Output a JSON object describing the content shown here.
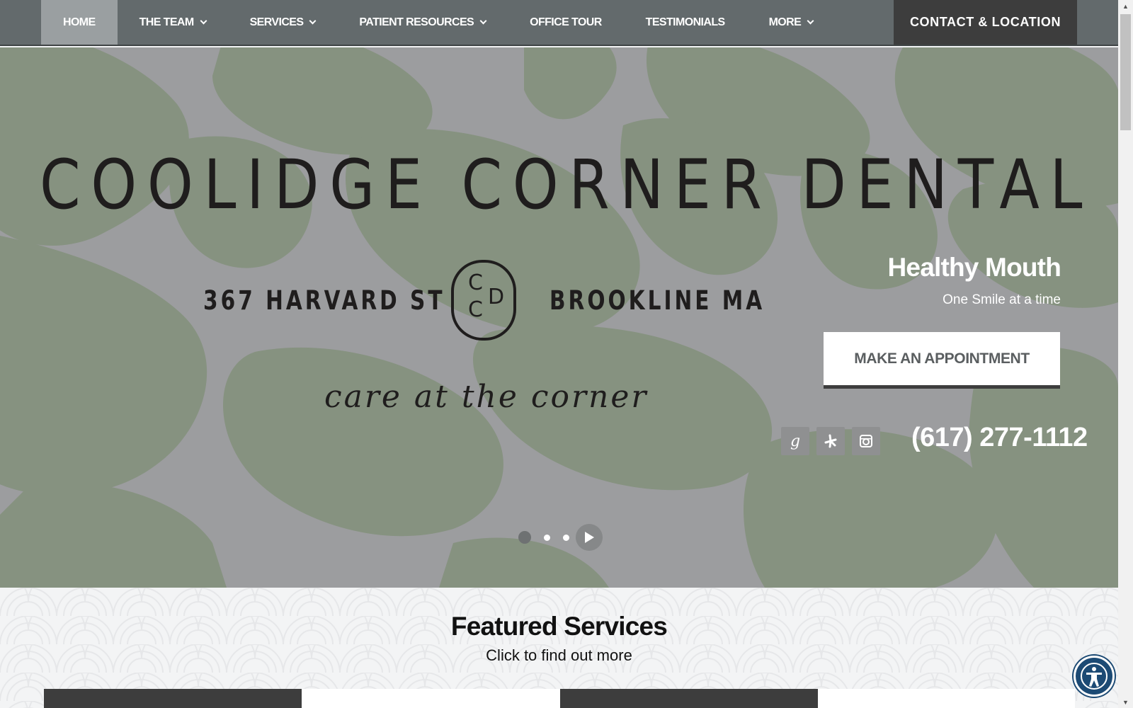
{
  "nav": {
    "items": [
      {
        "label": "HOME",
        "active": true,
        "dropdown": false
      },
      {
        "label": "THE TEAM",
        "active": false,
        "dropdown": true
      },
      {
        "label": "SERVICES",
        "active": false,
        "dropdown": true
      },
      {
        "label": "PATIENT RESOURCES",
        "active": false,
        "dropdown": true
      },
      {
        "label": "OFFICE TOUR",
        "active": false,
        "dropdown": false
      },
      {
        "label": "TESTIMONIALS",
        "active": false,
        "dropdown": false
      },
      {
        "label": "MORE",
        "active": false,
        "dropdown": true
      }
    ],
    "contact_label": "CONTACT & LOCATION"
  },
  "hero": {
    "brand": "COOLIDGE CORNER DENTAL",
    "address": "367 HARVARD ST",
    "city": "BROOKLINE MA",
    "logo_letters": [
      "C",
      "C",
      "D"
    ],
    "tagline": "care at the corner",
    "title": "Healthy Mouth",
    "subtitle": "One Smile at a time",
    "appointment_label": "MAKE AN APPOINTMENT",
    "phone": "(617) 277-1112",
    "social": [
      {
        "name": "google-icon",
        "glyph": "g"
      },
      {
        "name": "yelp-icon",
        "glyph": "✻"
      },
      {
        "name": "instagram-icon",
        "glyph": "◘"
      }
    ],
    "slides": 3,
    "active_slide": 1
  },
  "featured": {
    "title": "Featured Services",
    "subtitle": "Click to find out more"
  },
  "colors": {
    "nav_bg": "#636a6c",
    "nav_active": "#9a9fa1",
    "contact_bg": "#3d3d3d",
    "hero_green": "#869280",
    "hero_gray": "#9c9d9f",
    "a11y_blue": "#1c4a74"
  }
}
